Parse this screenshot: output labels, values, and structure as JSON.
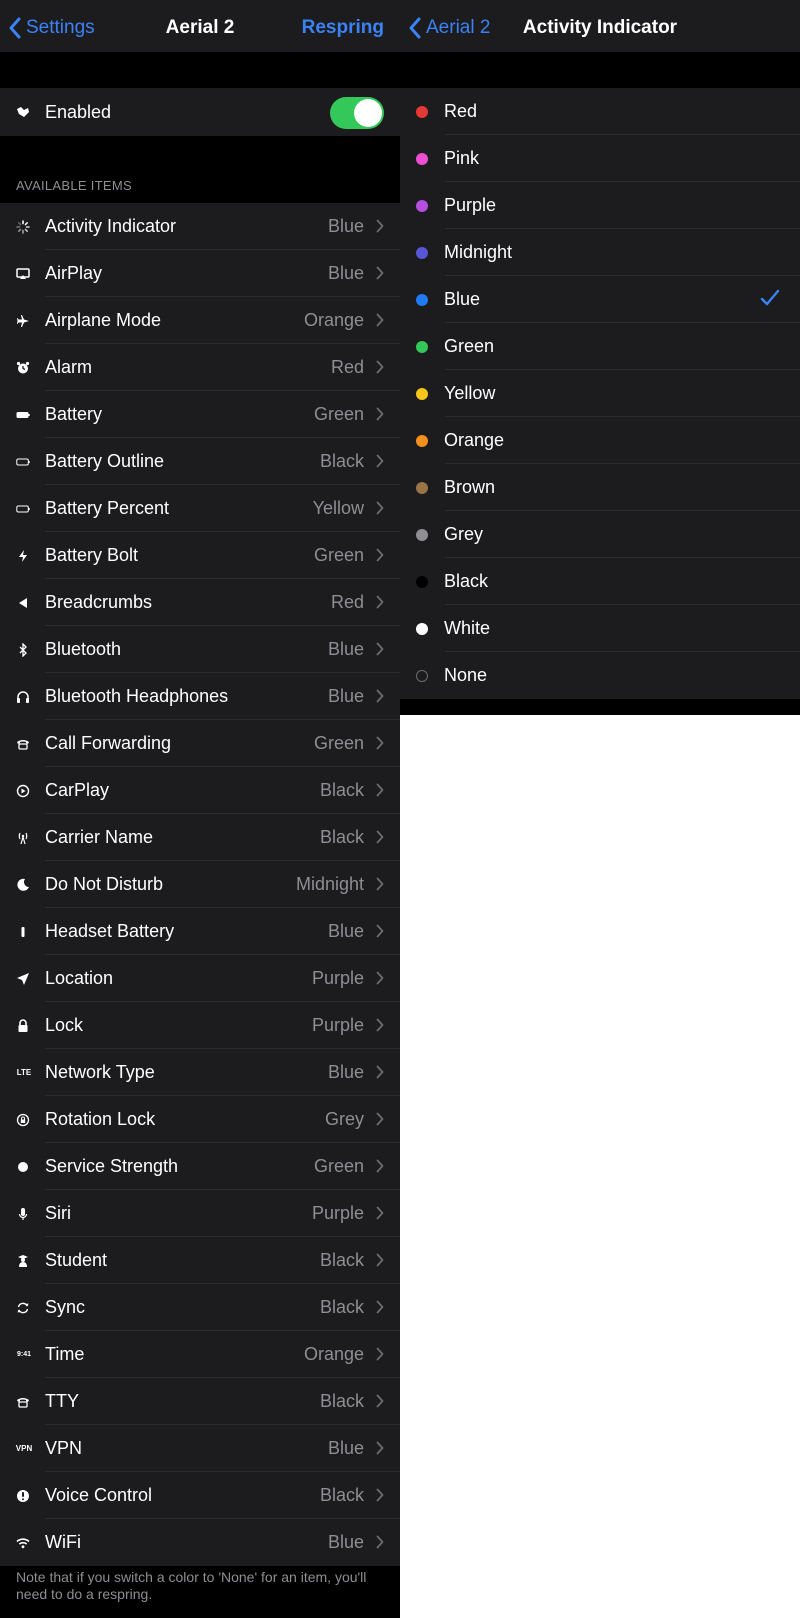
{
  "left": {
    "nav": {
      "back_label": "Settings",
      "title": "Aerial 2",
      "action_label": "Respring"
    },
    "enabled": {
      "label": "Enabled",
      "value": true
    },
    "section_header": "AVAILABLE ITEMS",
    "items": [
      {
        "label": "Activity Indicator",
        "value": "Blue",
        "icon": "activity-indicator-icon"
      },
      {
        "label": "AirPlay",
        "value": "Blue",
        "icon": "airplay-icon"
      },
      {
        "label": "Airplane Mode",
        "value": "Orange",
        "icon": "airplane-icon"
      },
      {
        "label": "Alarm",
        "value": "Red",
        "icon": "alarm-icon"
      },
      {
        "label": "Battery",
        "value": "Green",
        "icon": "battery-icon"
      },
      {
        "label": "Battery Outline",
        "value": "Black",
        "icon": "battery-outline-icon"
      },
      {
        "label": "Battery Percent",
        "value": "Yellow",
        "icon": "battery-percent-icon"
      },
      {
        "label": "Battery Bolt",
        "value": "Green",
        "icon": "bolt-icon"
      },
      {
        "label": "Breadcrumbs",
        "value": "Red",
        "icon": "breadcrumbs-icon"
      },
      {
        "label": "Bluetooth",
        "value": "Blue",
        "icon": "bluetooth-icon"
      },
      {
        "label": "Bluetooth Headphones",
        "value": "Blue",
        "icon": "headphones-icon"
      },
      {
        "label": "Call Forwarding",
        "value": "Green",
        "icon": "phone-icon"
      },
      {
        "label": "CarPlay",
        "value": "Black",
        "icon": "carplay-icon"
      },
      {
        "label": "Carrier Name",
        "value": "Black",
        "icon": "antenna-icon"
      },
      {
        "label": "Do Not Disturb",
        "value": "Midnight",
        "icon": "moon-icon"
      },
      {
        "label": "Headset Battery",
        "value": "Blue",
        "icon": "headset-battery-icon"
      },
      {
        "label": "Location",
        "value": "Purple",
        "icon": "location-icon"
      },
      {
        "label": "Lock",
        "value": "Purple",
        "icon": "lock-icon"
      },
      {
        "label": "Network Type",
        "value": "Blue",
        "icon": "lte-icon",
        "icon_text": "LTE"
      },
      {
        "label": "Rotation Lock",
        "value": "Grey",
        "icon": "rotation-lock-icon"
      },
      {
        "label": "Service Strength",
        "value": "Green",
        "icon": "signal-dot-icon"
      },
      {
        "label": "Siri",
        "value": "Purple",
        "icon": "microphone-icon"
      },
      {
        "label": "Student",
        "value": "Black",
        "icon": "student-icon"
      },
      {
        "label": "Sync",
        "value": "Black",
        "icon": "sync-icon"
      },
      {
        "label": "Time",
        "value": "Orange",
        "icon": "time-icon",
        "icon_text": "9:41"
      },
      {
        "label": "TTY",
        "value": "Black",
        "icon": "tty-icon"
      },
      {
        "label": "VPN",
        "value": "Blue",
        "icon": "vpn-icon",
        "icon_text": "VPN"
      },
      {
        "label": "Voice Control",
        "value": "Black",
        "icon": "voice-control-icon"
      },
      {
        "label": "WiFi",
        "value": "Blue",
        "icon": "wifi-icon"
      }
    ],
    "footer": "Note that if you switch a color to 'None' for an item, you'll need to do a respring."
  },
  "right": {
    "nav": {
      "back_label": "Aerial 2",
      "title": "Activity Indicator"
    },
    "colors": [
      {
        "label": "Red",
        "color": "#e53935"
      },
      {
        "label": "Pink",
        "color": "#ec4fd4"
      },
      {
        "label": "Purple",
        "color": "#b44fe0"
      },
      {
        "label": "Midnight",
        "color": "#5856d6"
      },
      {
        "label": "Blue",
        "color": "#1e7bf2",
        "selected": true
      },
      {
        "label": "Green",
        "color": "#34c759"
      },
      {
        "label": "Yellow",
        "color": "#f5c518"
      },
      {
        "label": "Orange",
        "color": "#f5901e"
      },
      {
        "label": "Brown",
        "color": "#9a7446"
      },
      {
        "label": "Grey",
        "color": "#8e8e93"
      },
      {
        "label": "Black",
        "color": "#000000"
      },
      {
        "label": "White",
        "color": "#ffffff"
      },
      {
        "label": "None",
        "color": "none"
      }
    ]
  },
  "accent_color": "#3b82f6"
}
